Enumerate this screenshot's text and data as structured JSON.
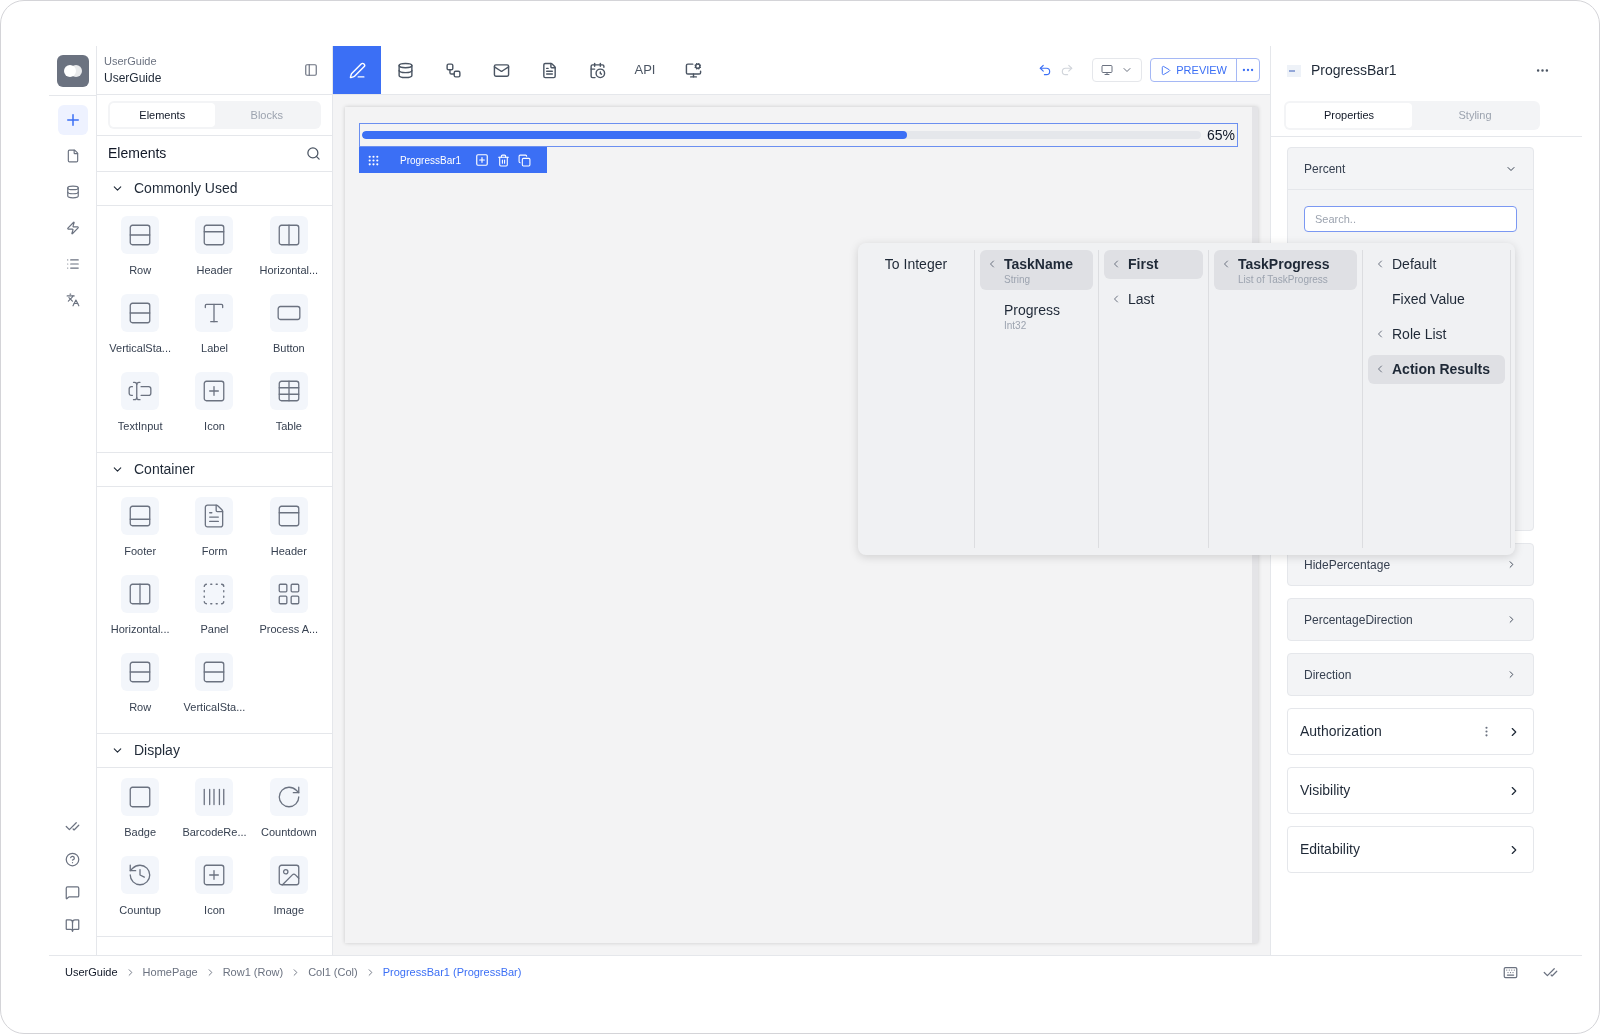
{
  "project": {
    "label": "UserGuide",
    "name": "UserGuide"
  },
  "rail": {
    "top": [
      {
        "kind": "add",
        "selected": true
      },
      {
        "kind": "page",
        "selected": false
      },
      {
        "kind": "database",
        "selected": false
      },
      {
        "kind": "action",
        "selected": false
      },
      {
        "kind": "list",
        "selected": false
      },
      {
        "kind": "translate",
        "selected": false
      }
    ],
    "bottom": [
      {
        "kind": "check"
      },
      {
        "kind": "help"
      },
      {
        "kind": "chat"
      },
      {
        "kind": "book"
      }
    ]
  },
  "left_panel": {
    "tabs": [
      {
        "label": "Elements",
        "selected": true
      },
      {
        "label": "Blocks",
        "selected": false
      }
    ],
    "title": "Elements",
    "sections": [
      {
        "title": "Commonly Used",
        "expanded": true,
        "items": [
          {
            "label": "Row",
            "kind": "row"
          },
          {
            "label": "Header",
            "kind": "header"
          },
          {
            "label": "Horizontal...",
            "kind": "columns"
          },
          {
            "label": "VerticalSta...",
            "kind": "stack"
          },
          {
            "label": "Label",
            "kind": "label"
          },
          {
            "label": "Button",
            "kind": "button"
          },
          {
            "label": "TextInput",
            "kind": "input"
          },
          {
            "label": "Icon",
            "kind": "icon"
          },
          {
            "label": "Table",
            "kind": "table"
          }
        ]
      },
      {
        "title": "Container",
        "expanded": true,
        "items": [
          {
            "label": "Footer",
            "kind": "footer"
          },
          {
            "label": "Form",
            "kind": "form"
          },
          {
            "label": "Header",
            "kind": "header"
          },
          {
            "label": "Horizontal...",
            "kind": "columns"
          },
          {
            "label": "Panel",
            "kind": "panel"
          },
          {
            "label": "Process A...",
            "kind": "process"
          },
          {
            "label": "Row",
            "kind": "row"
          },
          {
            "label": "VerticalSta...",
            "kind": "stack"
          }
        ]
      },
      {
        "title": "Display",
        "expanded": true,
        "items": [
          {
            "label": "Badge",
            "kind": "badge"
          },
          {
            "label": "BarcodeRe...",
            "kind": "barcode"
          },
          {
            "label": "Countdown",
            "kind": "countdown"
          },
          {
            "label": "Countup",
            "kind": "countup"
          },
          {
            "label": "Icon",
            "kind": "icon"
          },
          {
            "label": "Image",
            "kind": "image"
          }
        ]
      }
    ]
  },
  "toolbar": {
    "tools": [
      {
        "kind": "design",
        "selected": true
      },
      {
        "kind": "database",
        "selected": false
      },
      {
        "kind": "flow",
        "selected": false
      },
      {
        "kind": "mail",
        "selected": false
      },
      {
        "kind": "document",
        "selected": false
      },
      {
        "kind": "schedule",
        "selected": false
      },
      {
        "kind": "api",
        "label": "API",
        "selected": false
      },
      {
        "kind": "monitor",
        "selected": false
      }
    ],
    "preview": "PREVIEW"
  },
  "canvas": {
    "progress": {
      "level": 0.65,
      "reading": "65%"
    },
    "selection_label": "ProgressBar1"
  },
  "popup": {
    "columns": [
      {
        "items": [
          {
            "label": "To Integer",
            "selected": false,
            "submenu": false
          }
        ]
      },
      {
        "items": [
          {
            "label": "TaskName",
            "sublabel": "String",
            "selected": true,
            "submenu": true
          },
          {
            "label": "Progress",
            "sublabel": "Int32",
            "selected": false,
            "submenu": false
          }
        ]
      },
      {
        "items": [
          {
            "label": "First",
            "selected": true,
            "submenu": true
          },
          {
            "label": "Last",
            "selected": false,
            "submenu": true
          }
        ]
      },
      {
        "items": [
          {
            "label": "TaskProgress",
            "sublabel": "List of TaskProgress",
            "selected": true,
            "submenu": true
          }
        ]
      },
      {
        "items": [
          {
            "label": "Default",
            "selected": false,
            "submenu": true
          },
          {
            "label": "Fixed Value",
            "selected": false,
            "submenu": false
          },
          {
            "label": "Role List",
            "selected": false,
            "submenu": true
          },
          {
            "label": "Action Results",
            "selected": true,
            "submenu": true
          }
        ]
      }
    ]
  },
  "right_panel": {
    "title": "ProgressBar1",
    "tabs": [
      {
        "label": "Properties",
        "selected": true
      },
      {
        "label": "Styling",
        "selected": false
      }
    ],
    "percent": {
      "title": "Percent",
      "placeholder": "Search.."
    },
    "properties": [
      {
        "label": "HidePercentage",
        "kind": "field"
      },
      {
        "label": "PercentageDirection",
        "kind": "field"
      },
      {
        "label": "Direction",
        "kind": "field"
      },
      {
        "label": "Authorization",
        "kind": "section",
        "menu": true
      },
      {
        "label": "Visibility",
        "kind": "section",
        "menu": false
      },
      {
        "label": "Editability",
        "kind": "section",
        "menu": false
      }
    ]
  },
  "breadcrumb": [
    {
      "label": "UserGuide",
      "current": false
    },
    {
      "label": "HomePage",
      "current": false
    },
    {
      "label": "Row1 (Row)",
      "current": false
    },
    {
      "label": "Col1 (Col)",
      "current": false
    },
    {
      "label": "ProgressBar1 (ProgressBar)",
      "current": true
    }
  ]
}
